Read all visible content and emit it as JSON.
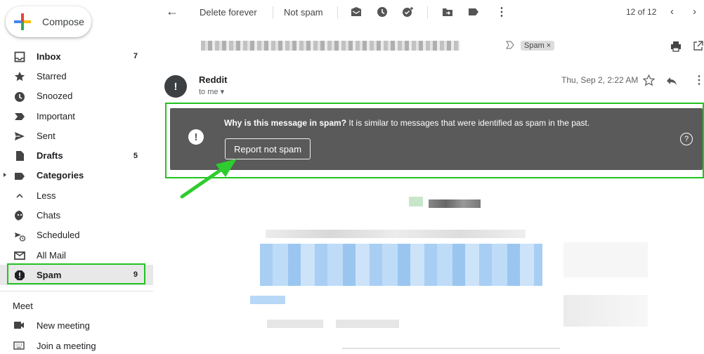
{
  "compose": {
    "label": "Compose"
  },
  "sidebar": {
    "items": [
      {
        "label": "Inbox",
        "count": "7",
        "bold": true,
        "icon": "inbox-icon"
      },
      {
        "label": "Starred",
        "count": "",
        "bold": false,
        "icon": "star-icon"
      },
      {
        "label": "Snoozed",
        "count": "",
        "bold": false,
        "icon": "clock-icon"
      },
      {
        "label": "Important",
        "count": "",
        "bold": false,
        "icon": "important-icon"
      },
      {
        "label": "Sent",
        "count": "",
        "bold": false,
        "icon": "send-icon"
      },
      {
        "label": "Drafts",
        "count": "5",
        "bold": true,
        "icon": "draft-icon"
      },
      {
        "label": "Categories",
        "count": "",
        "bold": true,
        "icon": "label-icon"
      },
      {
        "label": "Less",
        "count": "",
        "bold": false,
        "icon": "chevron-up-icon"
      },
      {
        "label": "Chats",
        "count": "",
        "bold": false,
        "icon": "chat-icon"
      },
      {
        "label": "Scheduled",
        "count": "",
        "bold": false,
        "icon": "scheduled-send-icon"
      },
      {
        "label": "All Mail",
        "count": "",
        "bold": false,
        "icon": "all-mail-icon"
      },
      {
        "label": "Spam",
        "count": "9",
        "bold": true,
        "icon": "spam-icon"
      }
    ]
  },
  "meet": {
    "title": "Meet",
    "items": [
      {
        "label": "New meeting",
        "icon": "video-icon"
      },
      {
        "label": "Join a meeting",
        "icon": "keyboard-icon"
      }
    ]
  },
  "toolbar": {
    "delete_forever": "Delete forever",
    "not_spam": "Not spam",
    "pager": "12 of 12"
  },
  "message": {
    "label_chip": "Spam ×",
    "sender": "Reddit",
    "to": "to me ▾",
    "date": "Thu, Sep 2, 2:22 AM"
  },
  "banner": {
    "question": "Why is this message in spam?",
    "explanation": " It is similar to messages that were identified as spam in the past.",
    "button": "Report not spam"
  },
  "colors": {
    "highlight": "#22c322",
    "banner_bg": "#5a5a5a",
    "compose_red": "#ea4335",
    "compose_blue": "#4285f4",
    "compose_yellow": "#fbbc04",
    "compose_green": "#34a853"
  }
}
